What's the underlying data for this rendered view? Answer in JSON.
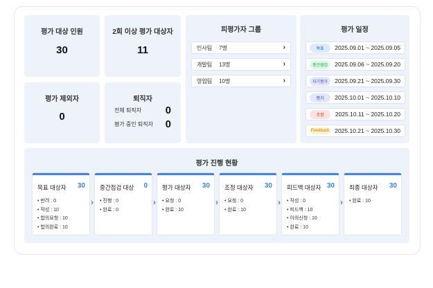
{
  "summary": {
    "target_title": "평가 대상 인원",
    "target_value": "30",
    "repeat_title": "2회 이상 평가 대상자",
    "repeat_value": "11",
    "excluded_title": "평가 제외자",
    "excluded_value": "0",
    "retired_title": "퇴직자",
    "retired_rows": [
      {
        "label": "전체 퇴직자",
        "value": "0"
      },
      {
        "label": "평가 중인 퇴직자",
        "value": "0"
      }
    ]
  },
  "groups": {
    "title": "피평가자 그룹",
    "items": [
      {
        "name": "인사팀",
        "count": "7명"
      },
      {
        "name": "개발팀",
        "count": "13명"
      },
      {
        "name": "영업팀",
        "count": "10명"
      }
    ],
    "chevron": "›"
  },
  "schedule": {
    "title": "평가 일정",
    "items": [
      {
        "badge": "목표",
        "dates": "2025.09.01 ~ 2025.09.05",
        "bg": "#dbeafe",
        "fg": "#2563eb"
      },
      {
        "badge": "중간점검",
        "dates": "2025.09.06 ~ 2025.09.20",
        "bg": "#dcfce7",
        "fg": "#16a34a"
      },
      {
        "badge": "자기평가",
        "dates": "2025.09.21 ~ 2025.09.30",
        "bg": "#e0e7ff",
        "fg": "#4f46e5"
      },
      {
        "badge": "평가",
        "dates": "2025.10.01 ~ 2025.10.10",
        "bg": "#e0e7ff",
        "fg": "#4338ca"
      },
      {
        "badge": "조정",
        "dates": "2025.10.11 ~ 2025.10.20",
        "bg": "#fee2e2",
        "fg": "#dc2626"
      },
      {
        "badge": "Feedback",
        "dates": "2025.10.21 ~ 2025.10.30",
        "bg": "#fef3c7",
        "fg": "#d97706"
      }
    ]
  },
  "progress": {
    "title": "평가 진행 현황",
    "arrow": "›",
    "stages": [
      {
        "name": "목표 대상자",
        "count": "30",
        "items": [
          "• 반려 : 0",
          "• 작성 : 10",
          "• 합의요청 : 10",
          "• 합의완료 : 10"
        ]
      },
      {
        "name": "중간점검 대상",
        "count": "0",
        "items": [
          "• 진행 : 0",
          "• 완료 : 0"
        ]
      },
      {
        "name": "평가 대상자",
        "count": "30",
        "items": [
          "• 요청 : 0",
          "• 완료 : 10"
        ]
      },
      {
        "name": "조정 대상자",
        "count": "30",
        "items": [
          "• 요청 : 0",
          "• 완료 : 10"
        ]
      },
      {
        "name": "피드백 대상자",
        "count": "30",
        "items": [
          "• 작성 : 0",
          "• 피드백 : 10",
          "• 이의신청 : 10",
          "• 완료 : 10"
        ]
      },
      {
        "name": "최종 대상자",
        "count": "30",
        "items": [
          "• 완료 : 10"
        ]
      }
    ]
  }
}
